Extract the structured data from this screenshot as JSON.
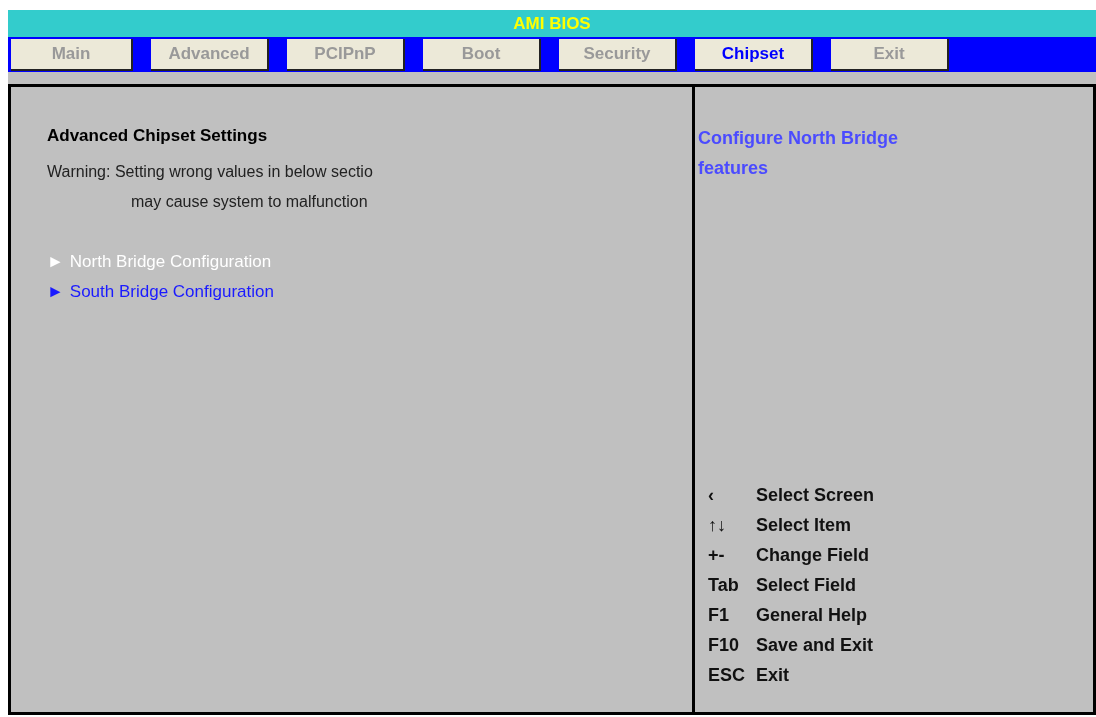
{
  "window": {
    "title": "AMI BIOS"
  },
  "tabs": [
    {
      "label": "Main",
      "selected": false
    },
    {
      "label": "Advanced",
      "selected": false
    },
    {
      "label": "PCIPnP",
      "selected": false
    },
    {
      "label": "Boot",
      "selected": false
    },
    {
      "label": "Security",
      "selected": false
    },
    {
      "label": "Chipset",
      "selected": true
    },
    {
      "label": "Exit",
      "selected": false
    }
  ],
  "main": {
    "heading": "Advanced Chipset Settings",
    "warning_lines": [
      "Warning: Setting wrong values in below sectio",
      "may cause system to malfunction"
    ],
    "items": [
      {
        "marker": "►",
        "label": "North Bridge Configuration",
        "selected": true
      },
      {
        "marker": "►",
        "label": "South Bridge Configuration",
        "selected": false
      }
    ]
  },
  "help": {
    "text": "Configure North Bridge features",
    "keys": [
      {
        "key": "‹",
        "action": "Select Screen"
      },
      {
        "key": "↑↓",
        "action": "Select Item"
      },
      {
        "key": "+-",
        "action": "Change Field"
      },
      {
        "key": "Tab",
        "action": "Select Field"
      },
      {
        "key": "F1",
        "action": "General Help"
      },
      {
        "key": "F10",
        "action": "Save and Exit"
      },
      {
        "key": "ESC",
        "action": "Exit"
      }
    ]
  }
}
